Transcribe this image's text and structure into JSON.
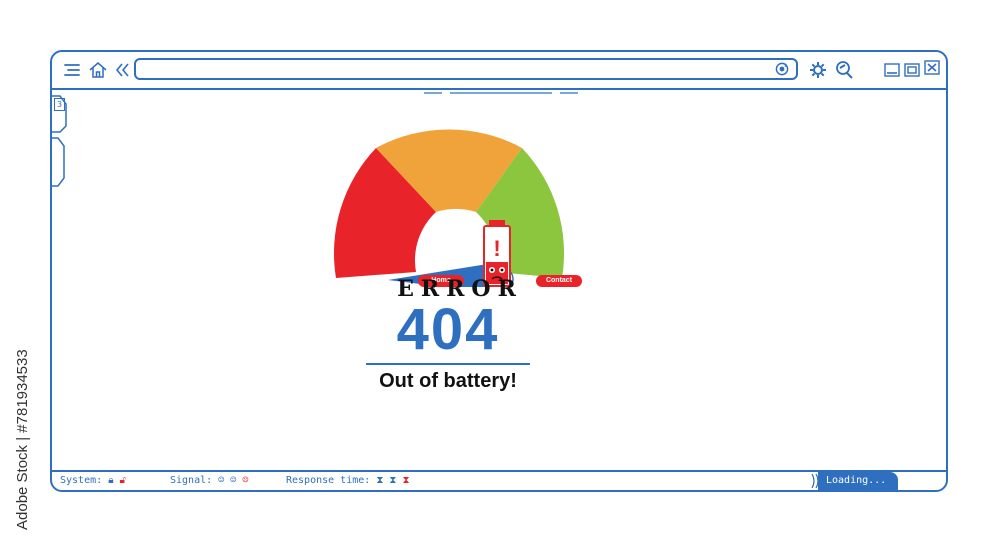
{
  "credit": {
    "text": "Adobe Stock | #781934533"
  },
  "toolbar": {
    "menu_icon": "menu-icon",
    "home_icon": "home-icon",
    "back_icon": "double-chevron-left-icon",
    "address_value": "",
    "refresh_icon": "refresh-icon",
    "settings_icon": "gear-icon",
    "search_icon": "search-icon",
    "minimize_icon": "minimize-icon",
    "maximize_icon": "maximize-icon",
    "close_icon": "close-icon"
  },
  "side_tab": {
    "label": "3"
  },
  "gauge": {
    "segments": [
      "#e8232a",
      "#f0a33a",
      "#8cc63f"
    ],
    "home_label": "Home",
    "contact_label": "Contact",
    "battery_mark": "!",
    "needle_color": "#2f6fc0"
  },
  "error": {
    "word": "ERROR",
    "code": "404",
    "message": "Out of battery!"
  },
  "status": {
    "system_label": "System:",
    "signal_label": "Signal:",
    "response_label": "Response time:",
    "loading_label": "Loading..."
  },
  "colors": {
    "accent": "#2f6fc0",
    "red": "#e8232a",
    "orange": "#f0a33a",
    "green": "#8cc63f"
  }
}
